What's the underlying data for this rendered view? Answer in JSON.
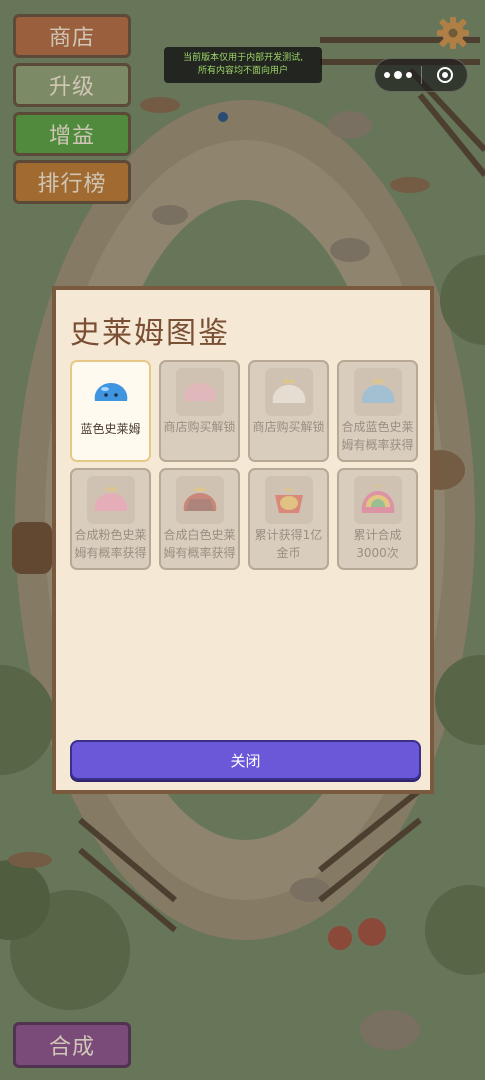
{
  "menu": {
    "shop": "商店",
    "upgrade": "升级",
    "buff": "增益",
    "rank": "排行榜",
    "merge": "合成"
  },
  "notice": {
    "line1": "当前版本仅用于内部开发测试,",
    "line2": "所有内容均不面向用户"
  },
  "modal": {
    "title": "史莱姆图鉴",
    "close_label": "关闭",
    "cards": [
      {
        "label": "蓝色史莱姆",
        "unlocked": true,
        "slime_color": "#3f95e0"
      },
      {
        "label": "商店购买解锁",
        "unlocked": false,
        "slime_color": "#e8a3b8"
      },
      {
        "label": "商店购买解锁",
        "unlocked": false,
        "slime_color": "#f4eee8"
      },
      {
        "label": "合成蓝色史莱姆有概率获得",
        "unlocked": false,
        "slime_color": "#6fb3e8"
      },
      {
        "label": "合成粉色史莱姆有概率获得",
        "unlocked": false,
        "slime_color": "#f08fb4"
      },
      {
        "label": "合成白色史莱姆有概率获得",
        "unlocked": false,
        "slime_color": "#b9433b"
      },
      {
        "label": "累计获得1亿金币",
        "unlocked": false,
        "slime_color": "#d9473a"
      },
      {
        "label": "累计合成3000次",
        "unlocked": false,
        "slime_color": "#e05a8a"
      }
    ]
  },
  "colors": {
    "close_button": "#6a58d8",
    "modal_bg": "#f5e9d6",
    "modal_border": "#7a5a3e"
  }
}
